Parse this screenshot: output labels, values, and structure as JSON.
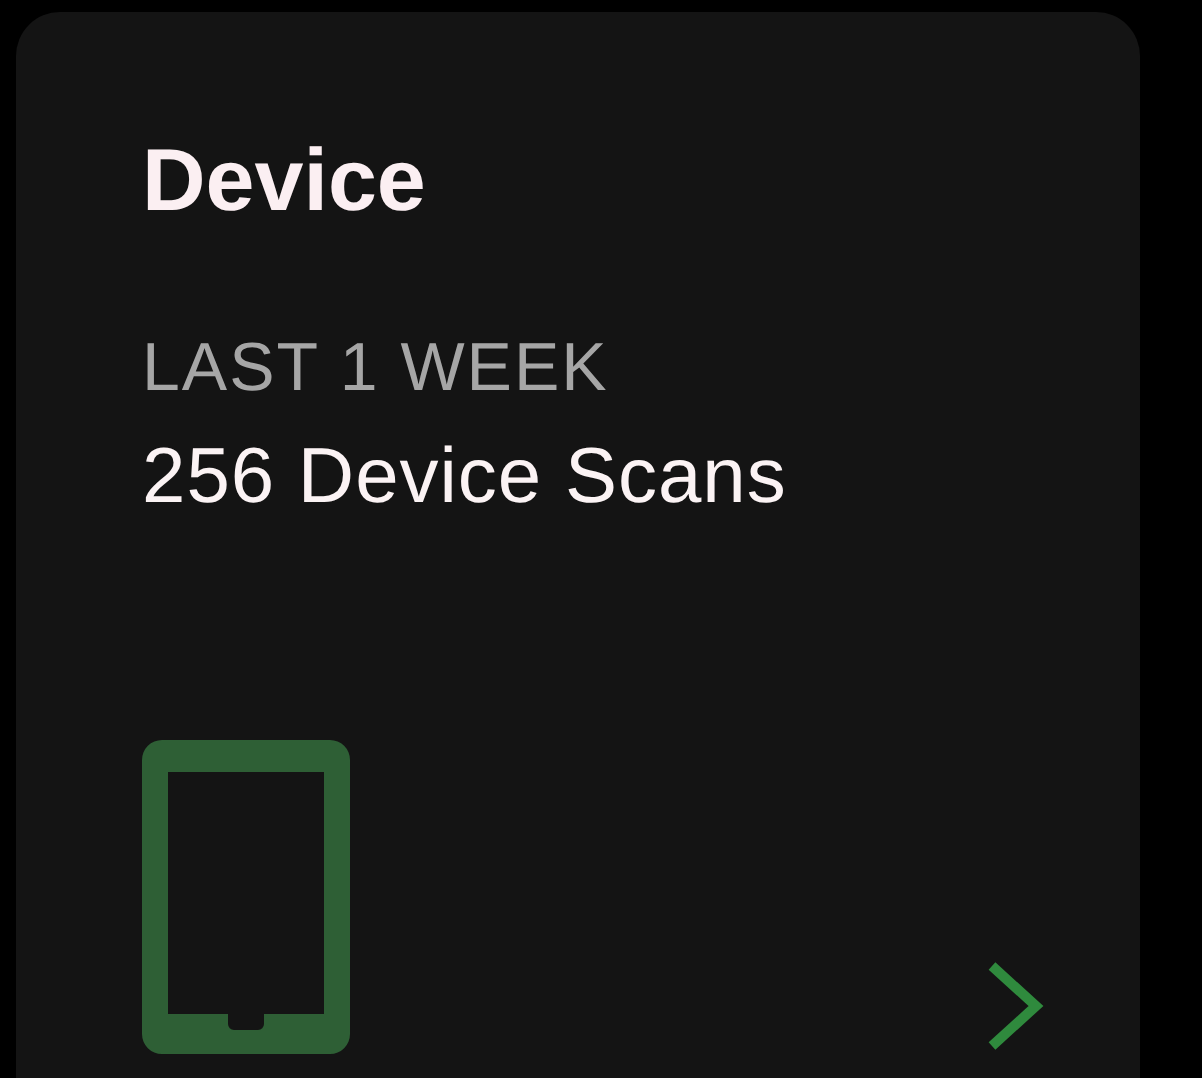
{
  "card": {
    "title": "Device",
    "period": "LAST 1 WEEK",
    "summary": "256 Device Scans"
  }
}
